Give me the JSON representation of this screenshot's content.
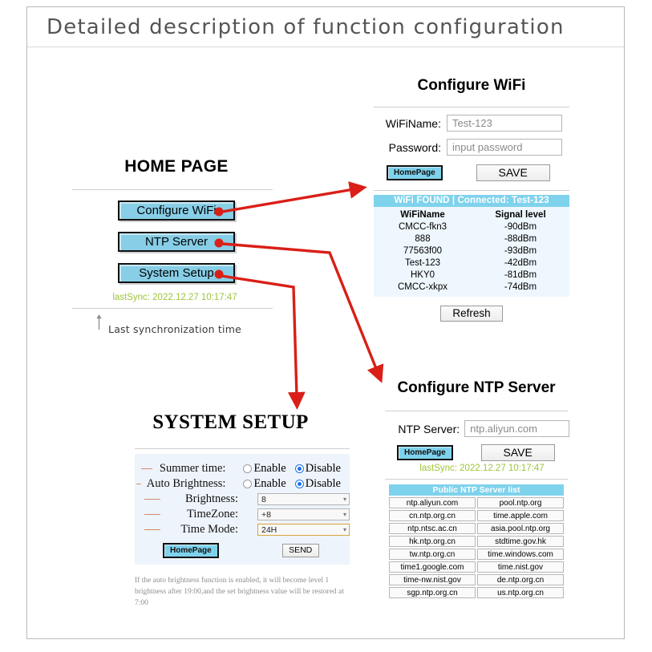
{
  "page": {
    "title": "Detailed description of function configuration"
  },
  "home": {
    "title": "HOME PAGE",
    "buttons": [
      {
        "label": "Configure WiFi"
      },
      {
        "label": "NTP Server"
      },
      {
        "label": "System Setup"
      }
    ],
    "lastsync": "lastSync: 2022.12.27 10:17:47",
    "caption": "Last synchronization time"
  },
  "wifi": {
    "title": "Configure WiFi",
    "name_label": "WiFiName:",
    "name_value": "Test-123",
    "password_label": "Password:",
    "password_placeholder": "input password",
    "home_button": "HomePage",
    "save_button": "SAVE",
    "list_header": "WiFi FOUND  |  Connected: Test-123",
    "col_name": "WiFiName",
    "col_signal": "Signal level",
    "networks": [
      {
        "name": "CMCC-fkn3",
        "signal": "-90dBm"
      },
      {
        "name": "888",
        "signal": "-88dBm"
      },
      {
        "name": "77563f00",
        "signal": "-93dBm"
      },
      {
        "name": "Test-123",
        "signal": "-42dBm"
      },
      {
        "name": "HKY0",
        "signal": "-81dBm"
      },
      {
        "name": "CMCC-xkpx",
        "signal": "-74dBm"
      }
    ],
    "refresh_button": "Refresh"
  },
  "system": {
    "title": "SYSTEM SETUP",
    "rows": [
      {
        "label": "Summer time:",
        "type": "radio",
        "enable": "Enable",
        "disable": "Disable",
        "selected": "Disable"
      },
      {
        "label": "Auto Brightness:",
        "type": "radio",
        "enable": "Enable",
        "disable": "Disable",
        "selected": "Disable"
      },
      {
        "label": "Brightness:",
        "type": "select",
        "value": "8"
      },
      {
        "label": "TimeZone:",
        "type": "select",
        "value": "+8"
      },
      {
        "label": "Time Mode:",
        "type": "select",
        "value": "24H"
      }
    ],
    "home_button": "HomePage",
    "send_button": "SEND",
    "note": "If the auto brightness function is enabled, it will become level 1 brightness after 19:00,and the set brightness value will be restored at 7:00"
  },
  "ntp": {
    "title": "Configure NTP Server",
    "server_label": "NTP Server:",
    "server_value": "ntp.aliyun.com",
    "home_button": "HomePage",
    "save_button": "SAVE",
    "lastsync": "lastSync: 2022.12.27 10:17:47",
    "list_header": "Public NTP Server list",
    "servers": [
      [
        "ntp.aliyun.com",
        "pool.ntp.org"
      ],
      [
        "cn.ntp.org.cn",
        "time.apple.com"
      ],
      [
        "ntp.ntsc.ac.cn",
        "asia.pool.ntp.org"
      ],
      [
        "hk.ntp.org.cn",
        "stdtime.gov.hk"
      ],
      [
        "tw.ntp.org.cn",
        "time.windows.com"
      ],
      [
        "time1.google.com",
        "time.nist.gov"
      ],
      [
        "time-nw.nist.gov",
        "de.ntp.org.cn"
      ],
      [
        "sgp.ntp.org.cn",
        "us.ntp.org.cn"
      ]
    ]
  },
  "colors": {
    "accent_blue": "#87cee6",
    "header_blue": "#7fd2ec",
    "arrow_red": "#d91f17",
    "lastsync_green": "#9dc53a",
    "dash_salmon": "#d08b6f"
  }
}
